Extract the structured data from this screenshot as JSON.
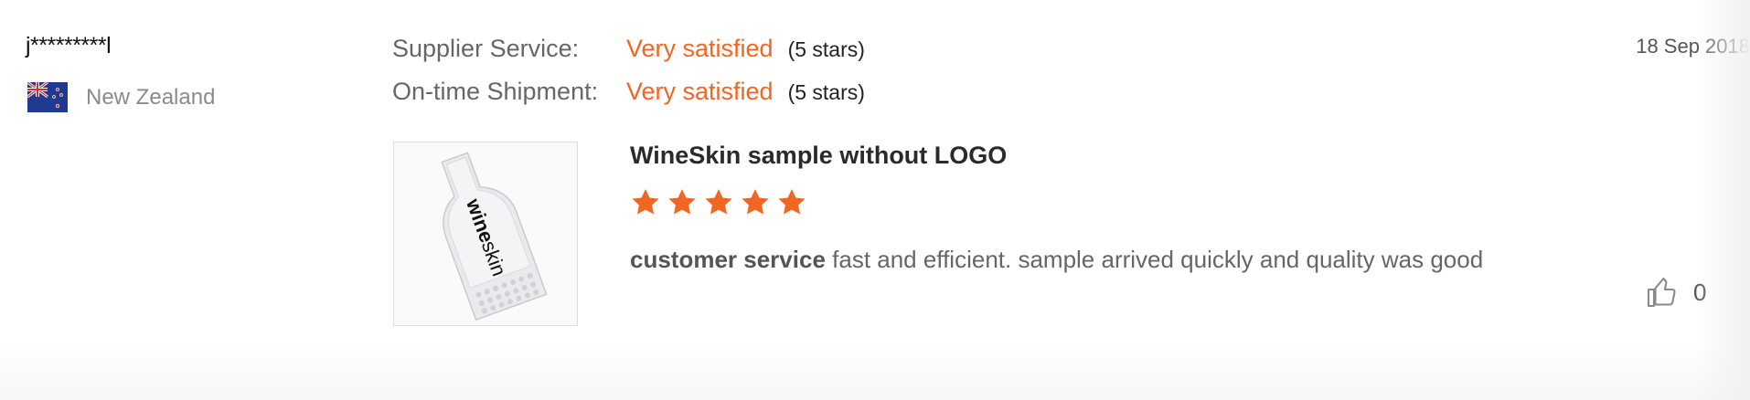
{
  "buyer": {
    "name": "j*********l",
    "country": "New Zealand",
    "flag_icon": "new-zealand-flag-icon"
  },
  "ratings": [
    {
      "label": "Supplier Service:",
      "value": "Very satisfied",
      "stars_text": "(5 stars)"
    },
    {
      "label": "On-time Shipment:",
      "value": "Very satisfied",
      "stars_text": "(5 stars)"
    }
  ],
  "date": "18 Sep 2018",
  "product": {
    "title": "WineSkin sample without LOGO",
    "thumbnail_text_bold": "wine",
    "thumbnail_text_regular": "skin",
    "rating": 5,
    "rating_max": 5
  },
  "review": {
    "highlight": "customer service",
    "text": " fast and efficient.  sample arrived quickly and quality was good"
  },
  "like": {
    "icon": "thumbs-up-icon",
    "count": "0"
  },
  "colors": {
    "accent": "#f26522",
    "label": "#666666",
    "muted": "#8b8b8b"
  }
}
